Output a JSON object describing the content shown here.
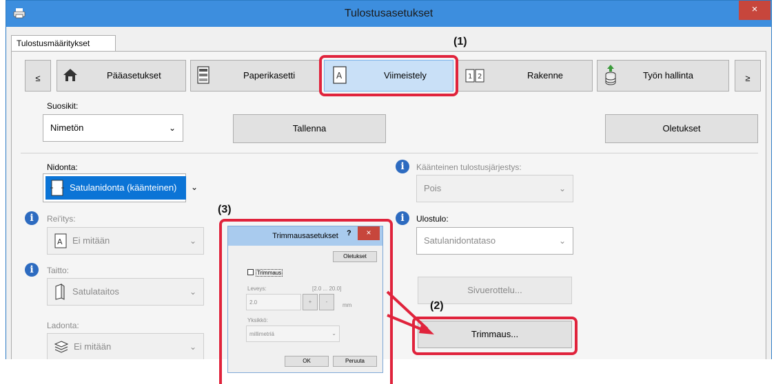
{
  "window": {
    "title": "Tulostusasetukset",
    "close": "×"
  },
  "tabs": {
    "active": "Tulostusmääritykset"
  },
  "nav": {
    "prev": "≤",
    "next": "≥",
    "items": [
      {
        "label": "Pääasetukset",
        "icon": "home-icon"
      },
      {
        "label": "Paperikasetti",
        "icon": "paper-tray-icon"
      },
      {
        "label": "Viimeistely",
        "icon": "finishing-icon"
      },
      {
        "label": "Rakenne",
        "icon": "layout-icon",
        "badge": "1|2"
      },
      {
        "label": "Työn hallinta",
        "icon": "job-handling-icon"
      }
    ]
  },
  "favorites": {
    "label": "Suosikit:",
    "value": "Nimetön",
    "save": "Tallenna",
    "defaults": "Oletukset"
  },
  "left": {
    "binding": {
      "label": "Nidonta:",
      "value": "Satulanidonta (käänteinen)",
      "icon_text": "A"
    },
    "punch": {
      "label": "Rei'itys:",
      "value": "Ei mitään",
      "icon_text": "A"
    },
    "fold": {
      "label": "Taitto:",
      "value": "Satulataitos"
    },
    "offset": {
      "label": "Ladonta:",
      "value": "Ei mitään"
    }
  },
  "right": {
    "reverse": {
      "label": "Käänteinen tulostusjärjestys:",
      "value": "Pois"
    },
    "output": {
      "label": "Ulostulo:",
      "value": "Satulanidontataso"
    },
    "separator": "Sivuerottelu...",
    "trimming": "Trimmaus..."
  },
  "dialog": {
    "title": "Trimmausasetukset",
    "help": "?",
    "close": "×",
    "defaults": "Oletukset",
    "checkbox": "Trimmaus",
    "width_label": "Leveys:",
    "range": "[2.0 ... 20.0]",
    "width_value": "2.0",
    "plus": "+",
    "minus": "-",
    "unit": "mm",
    "unit_label": "Yksikkö:",
    "unit_value": "millimetriä",
    "ok": "OK",
    "cancel": "Peruuta"
  },
  "callouts": {
    "c1": "(1)",
    "c2": "(2)",
    "c3": "(3)"
  },
  "colors": {
    "callout": "#e0233c",
    "titlebar": "#3d8ede",
    "info": "#2d6bc0"
  }
}
